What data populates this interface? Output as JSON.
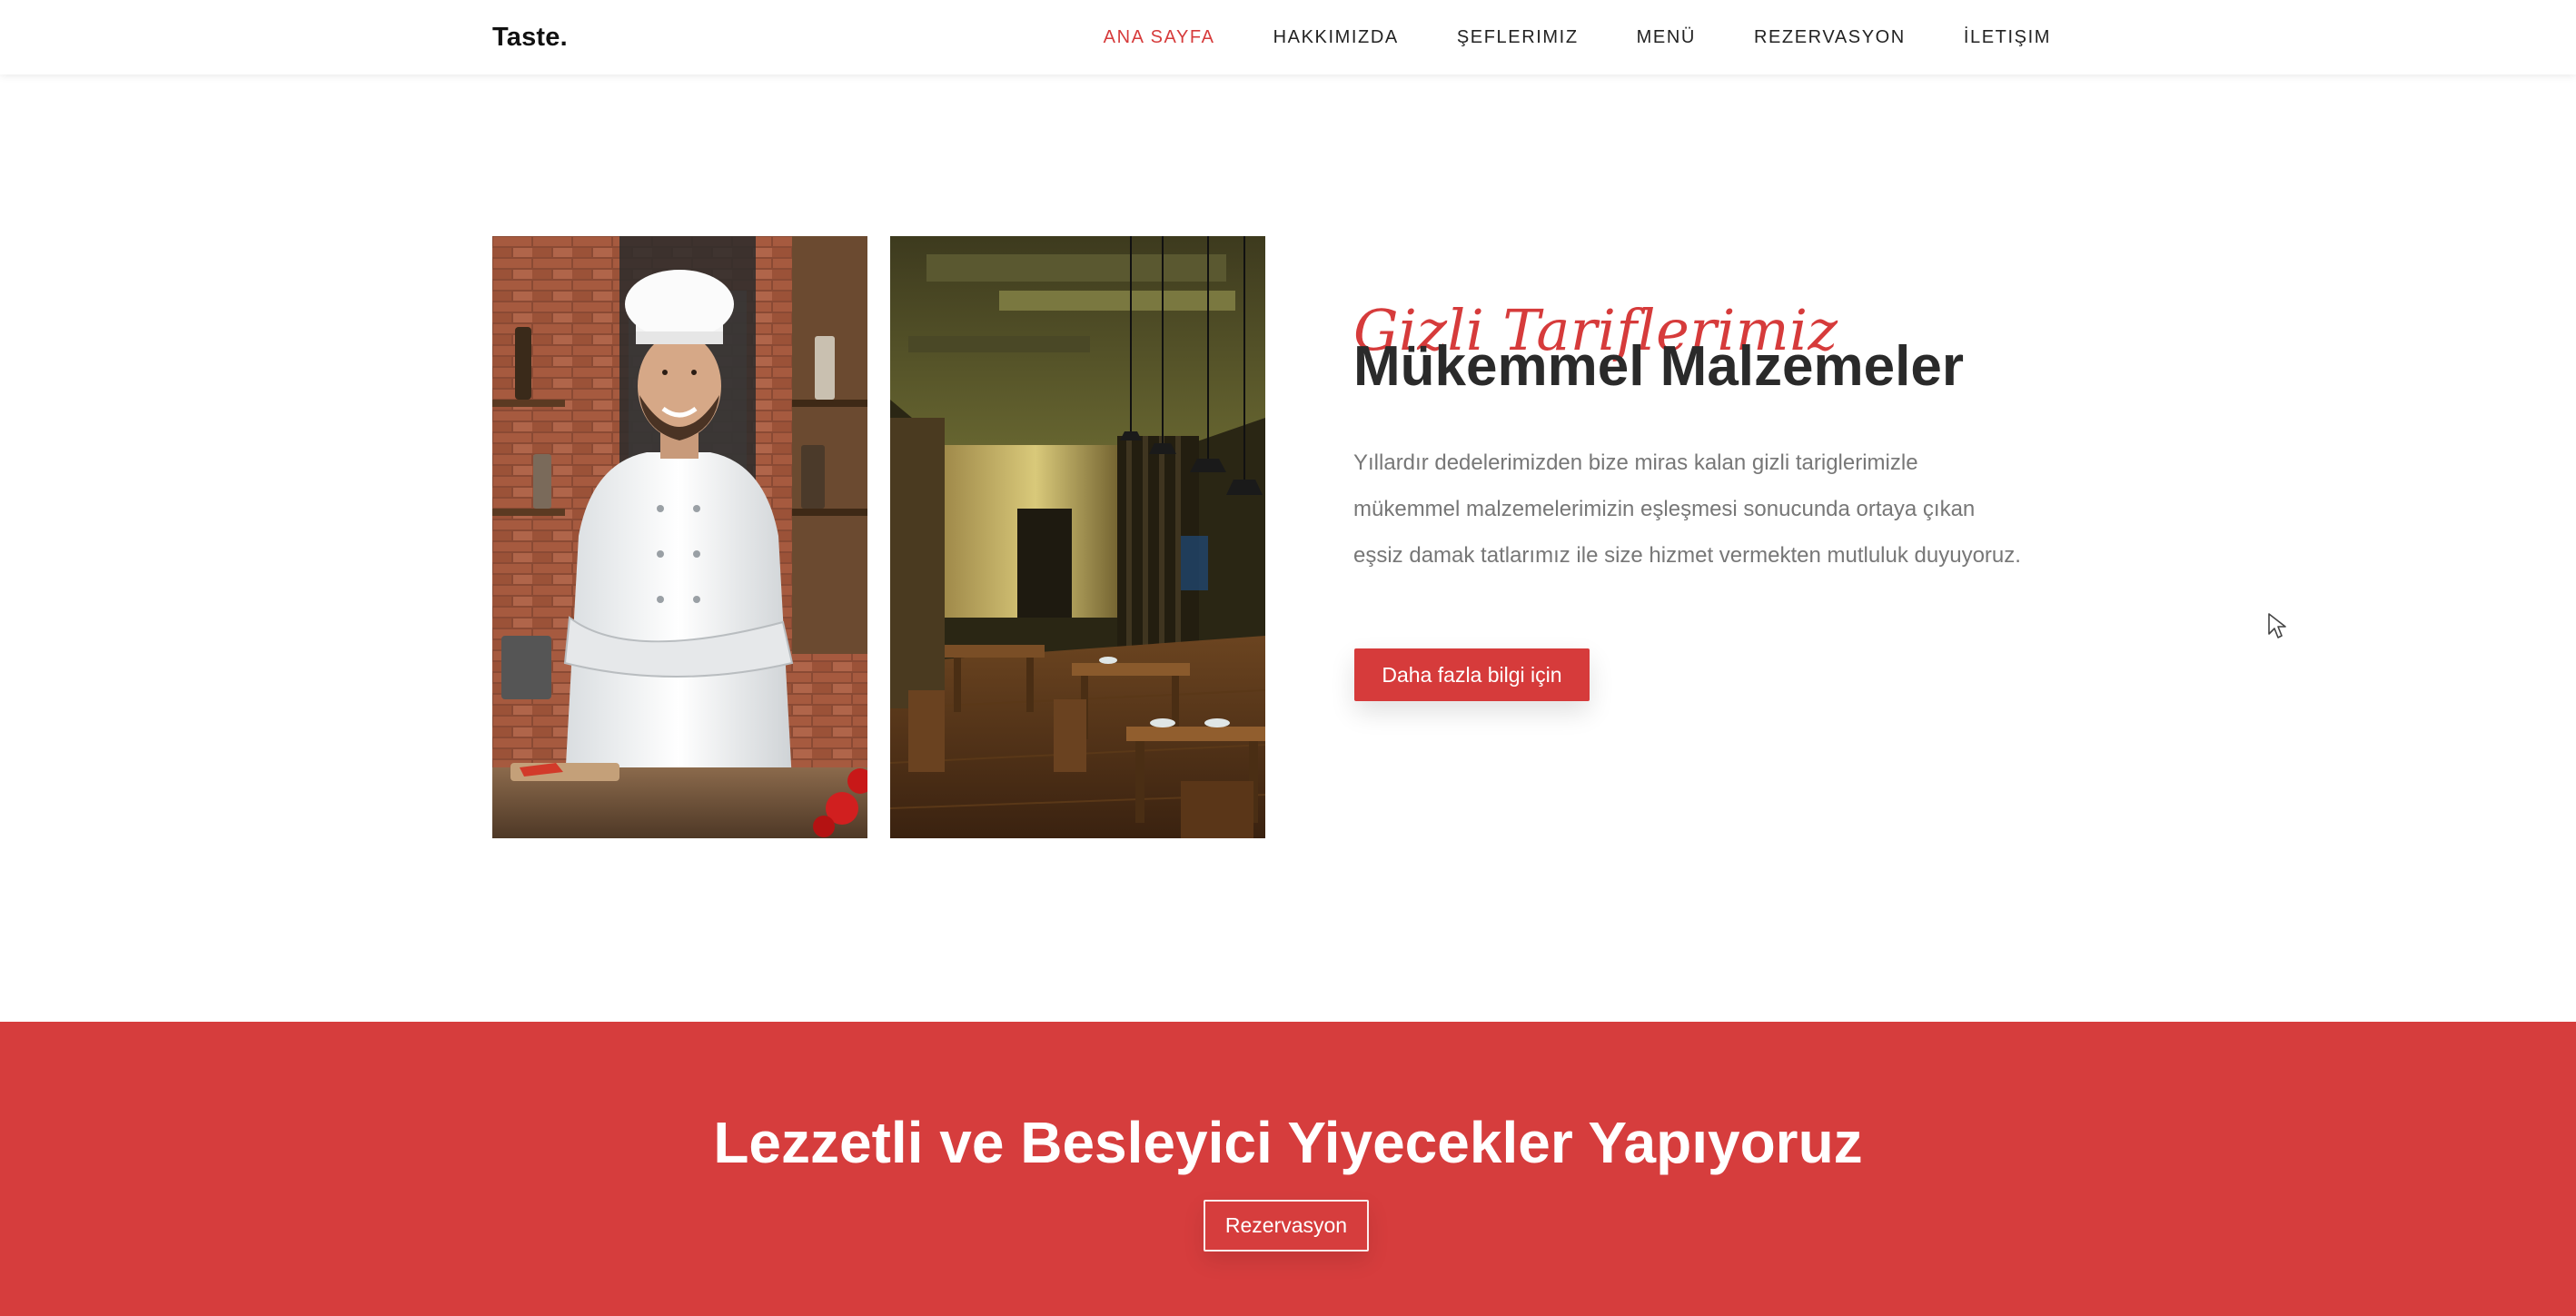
{
  "brand": {
    "name": "Taste."
  },
  "nav": {
    "items": [
      {
        "label": "ANA SAYFA",
        "active": true
      },
      {
        "label": "HAKKIMIZDA",
        "active": false
      },
      {
        "label": "ŞEFLERIMIZ",
        "active": false
      },
      {
        "label": "MENÜ",
        "active": false
      },
      {
        "label": "REZERVASYON",
        "active": false
      },
      {
        "label": "İLETIŞIM",
        "active": false
      }
    ]
  },
  "about": {
    "script_title": "Gizli Tariflerimiz",
    "title": "Mükemmel Malzemeler",
    "text": "Yıllardır dedelerimizden bize miras kalan gizli tariglerimizle mükemmel malzemelerimizin eşleşmesi sonucunda ortaya çıkan eşsiz damak tatlarımız ile size hizmet vermekten mutluluk duyuyoruz.",
    "button_label": "Daha fazla bilgi için",
    "images": [
      "chef-photo",
      "restaurant-interior-photo"
    ]
  },
  "cta": {
    "title": "Lezzetli ve Besleyici Yiyecekler Yapıyoruz",
    "button_label": "Rezervasyon"
  },
  "colors": {
    "accent": "#d63b3b",
    "heading": "#2a2a2a",
    "body_text": "#777777",
    "band": "#d63d3d"
  }
}
